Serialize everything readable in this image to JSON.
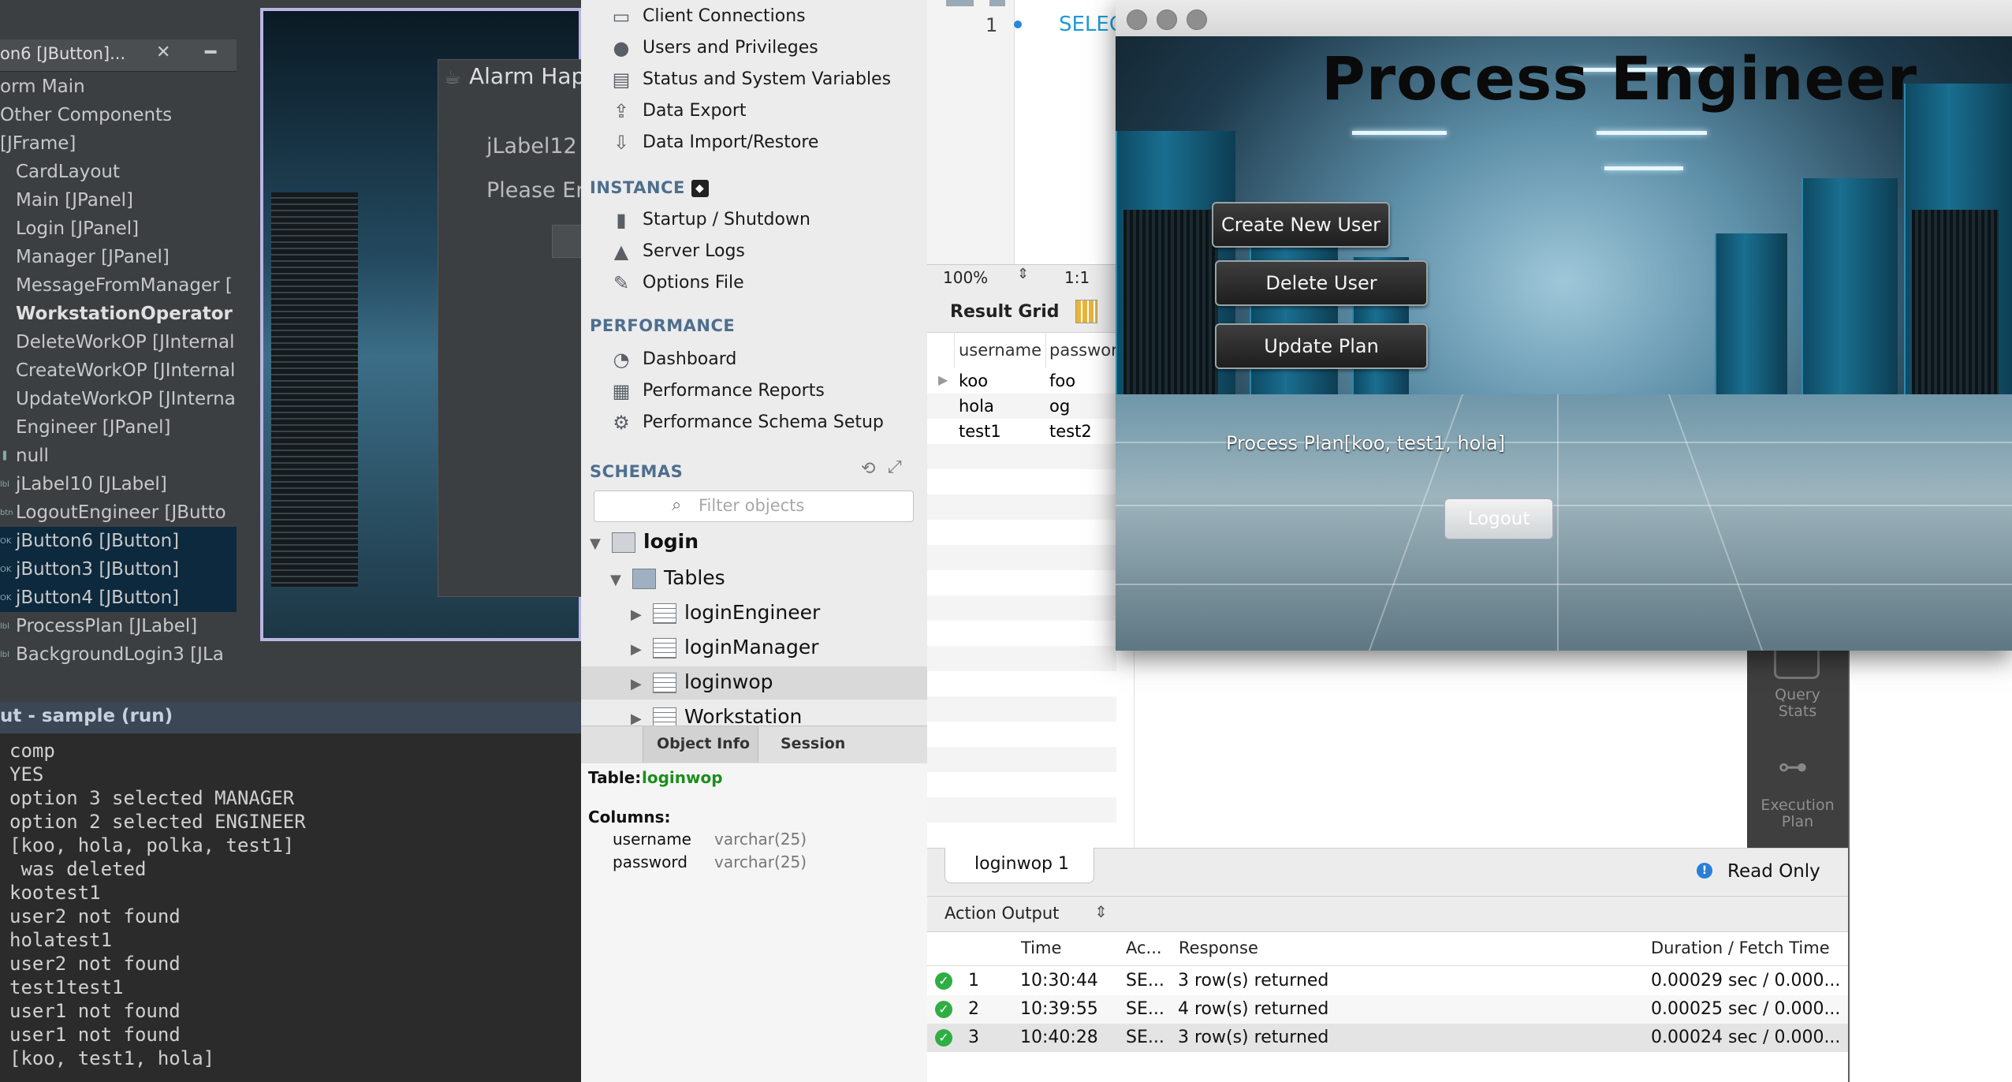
{
  "ide": {
    "tab_title": "on6 [JButton]...",
    "tab_close": "✕",
    "tab_minimize": "━",
    "tree": [
      {
        "label": "orm Main",
        "selected": false,
        "bold": false
      },
      {
        "label": "Other Components",
        "selected": false,
        "bold": false
      },
      {
        "label": "[JFrame]",
        "selected": false,
        "bold": false
      },
      {
        "label": "CardLayout",
        "selected": false,
        "bold": false
      },
      {
        "label": "Main [JPanel]",
        "selected": false,
        "bold": false
      },
      {
        "label": "Login [JPanel]",
        "selected": false,
        "bold": false
      },
      {
        "label": "Manager [JPanel]",
        "selected": false,
        "bold": false
      },
      {
        "label": "MessageFromManager [",
        "selected": false,
        "bold": false
      },
      {
        "label": "WorkstationOperator [",
        "selected": false,
        "bold": true
      },
      {
        "label": "DeleteWorkOP [JInternal",
        "selected": false,
        "bold": false
      },
      {
        "label": "CreateWorkOP [JInternal",
        "selected": false,
        "bold": false
      },
      {
        "label": "UpdateWorkOP [JInterna",
        "selected": false,
        "bold": false
      },
      {
        "label": "Engineer [JPanel]",
        "selected": false,
        "bold": false
      },
      {
        "label": "null",
        "selected": false,
        "bold": false
      },
      {
        "label": "jLabel10 [JLabel]",
        "selected": false,
        "bold": false
      },
      {
        "label": "LogoutEngineer [JButto",
        "selected": false,
        "bold": false
      },
      {
        "label": "jButton6 [JButton]",
        "selected": true,
        "bold": false
      },
      {
        "label": "jButton3 [JButton]",
        "selected": true,
        "bold": false
      },
      {
        "label": "jButton4 [JButton]",
        "selected": true,
        "bold": false
      },
      {
        "label": "ProcessPlan [JLabel]",
        "selected": false,
        "bold": false
      },
      {
        "label": "BackgroundLogin3 [JLa",
        "selected": false,
        "bold": false
      }
    ],
    "preview": {
      "dialog_title": "Alarm Hap",
      "label1": "jLabel12",
      "label2": "Please En"
    },
    "output": {
      "title": "ut - sample (run)",
      "lines": [
        "comp",
        "YES",
        "option 3 selected MANAGER",
        "option 2 selected ENGINEER",
        "[koo, hola, polka, test1]",
        " was deleted",
        "kootest1",
        "user2 not found",
        "holatest1",
        "user2 not found",
        "test1test1",
        "user1 not found",
        "user1 not found",
        "[koo, test1, hola]"
      ]
    }
  },
  "workbench": {
    "management_items": [
      {
        "label": "Client Connections",
        "icon": "monitor-icon"
      },
      {
        "label": "Users and Privileges",
        "icon": "user-icon"
      },
      {
        "label": "Status and System Variables",
        "icon": "status-icon"
      },
      {
        "label": "Data Export",
        "icon": "upload-icon"
      },
      {
        "label": "Data Import/Restore",
        "icon": "download-icon"
      }
    ],
    "instance_label": "INSTANCE",
    "instance_items": [
      {
        "label": "Startup / Shutdown",
        "icon": "power-icon"
      },
      {
        "label": "Server Logs",
        "icon": "warning-icon"
      },
      {
        "label": "Options File",
        "icon": "wrench-icon"
      }
    ],
    "performance_label": "PERFORMANCE",
    "performance_items": [
      {
        "label": "Dashboard",
        "icon": "gauge-icon"
      },
      {
        "label": "Performance Reports",
        "icon": "report-icon"
      },
      {
        "label": "Performance Schema Setup",
        "icon": "wrench-gear-icon"
      }
    ],
    "schemas_label": "SCHEMAS",
    "filter_placeholder": "Filter objects",
    "schema_tree": {
      "db": "login",
      "tables_label": "Tables",
      "tables": [
        "loginEngineer",
        "loginManager",
        "loginwop",
        "Workstation"
      ]
    },
    "info_tabs": [
      "Object Info",
      "Session"
    ],
    "object_info": {
      "table_label": "Table:",
      "table_name": "loginwop",
      "columns_label": "Columns:",
      "columns": [
        {
          "name": "username",
          "type": "varchar(25)"
        },
        {
          "name": "password",
          "type": "varchar(25)"
        }
      ]
    }
  },
  "editor": {
    "line_number": "1",
    "sql_fragment": "SELEC",
    "zoom": "100%",
    "position": "1:1",
    "result_grid_label": "Result Grid",
    "grid_headers": [
      "username",
      "passwor"
    ],
    "grid_rows": [
      [
        "koo",
        "foo"
      ],
      [
        "hola",
        "og"
      ],
      [
        "test1",
        "test2"
      ]
    ],
    "side_buttons": [
      {
        "label": "Query\nStats"
      },
      {
        "label": "Execution\nPlan"
      }
    ],
    "result_tab": "loginwop 1",
    "read_only": "Read Only",
    "action_output_label": "Action Output",
    "action_headers": [
      "Time",
      "Ac...",
      "Response",
      "Duration / Fetch Time"
    ],
    "actions": [
      {
        "n": "1",
        "time": "10:30:44",
        "action": "SE...",
        "response": "3 row(s) returned",
        "duration": "0.00029 sec / 0.000..."
      },
      {
        "n": "2",
        "time": "10:39:55",
        "action": "SE...",
        "response": "4 row(s) returned",
        "duration": "0.00025 sec / 0.000..."
      },
      {
        "n": "3",
        "time": "10:40:28",
        "action": "SE...",
        "response": "3 row(s) returned",
        "duration": "0.00024 sec / 0.000..."
      }
    ]
  },
  "app": {
    "title": "Process Engineer",
    "buttons": [
      "Create New User",
      "Delete User",
      "Update Plan"
    ],
    "process_plan": "Process Plan[koo, test1, hola]",
    "logout": "Logout"
  }
}
